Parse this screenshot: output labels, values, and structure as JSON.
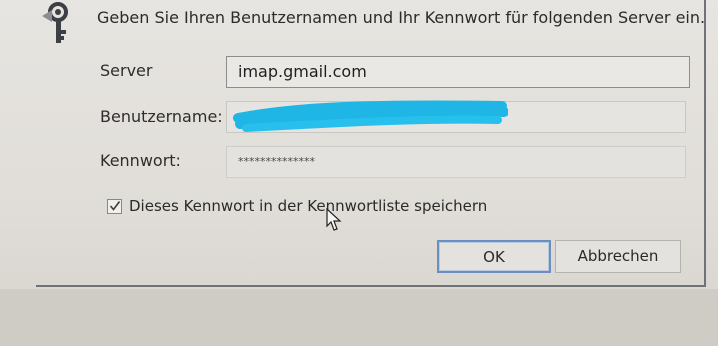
{
  "dialog": {
    "prompt": "Geben Sie Ihren Benutzernamen und Ihr Kennwort für folgenden Server ein.",
    "icon": "key-icon",
    "fields": {
      "server_label": "Server",
      "server_value": "imap.gmail.com",
      "username_label": "Benutzername:",
      "username_value": "",
      "password_label": "Kennwort:",
      "password_value": "**************"
    },
    "save_password": {
      "checked": true,
      "label": "Dieses Kennwort in der Kennwortliste speichern"
    },
    "buttons": {
      "ok": "OK",
      "cancel": "Abbrechen"
    },
    "colors": {
      "redaction": "#1fb6e6",
      "ok_focus_border": "#6b8fbf"
    }
  }
}
